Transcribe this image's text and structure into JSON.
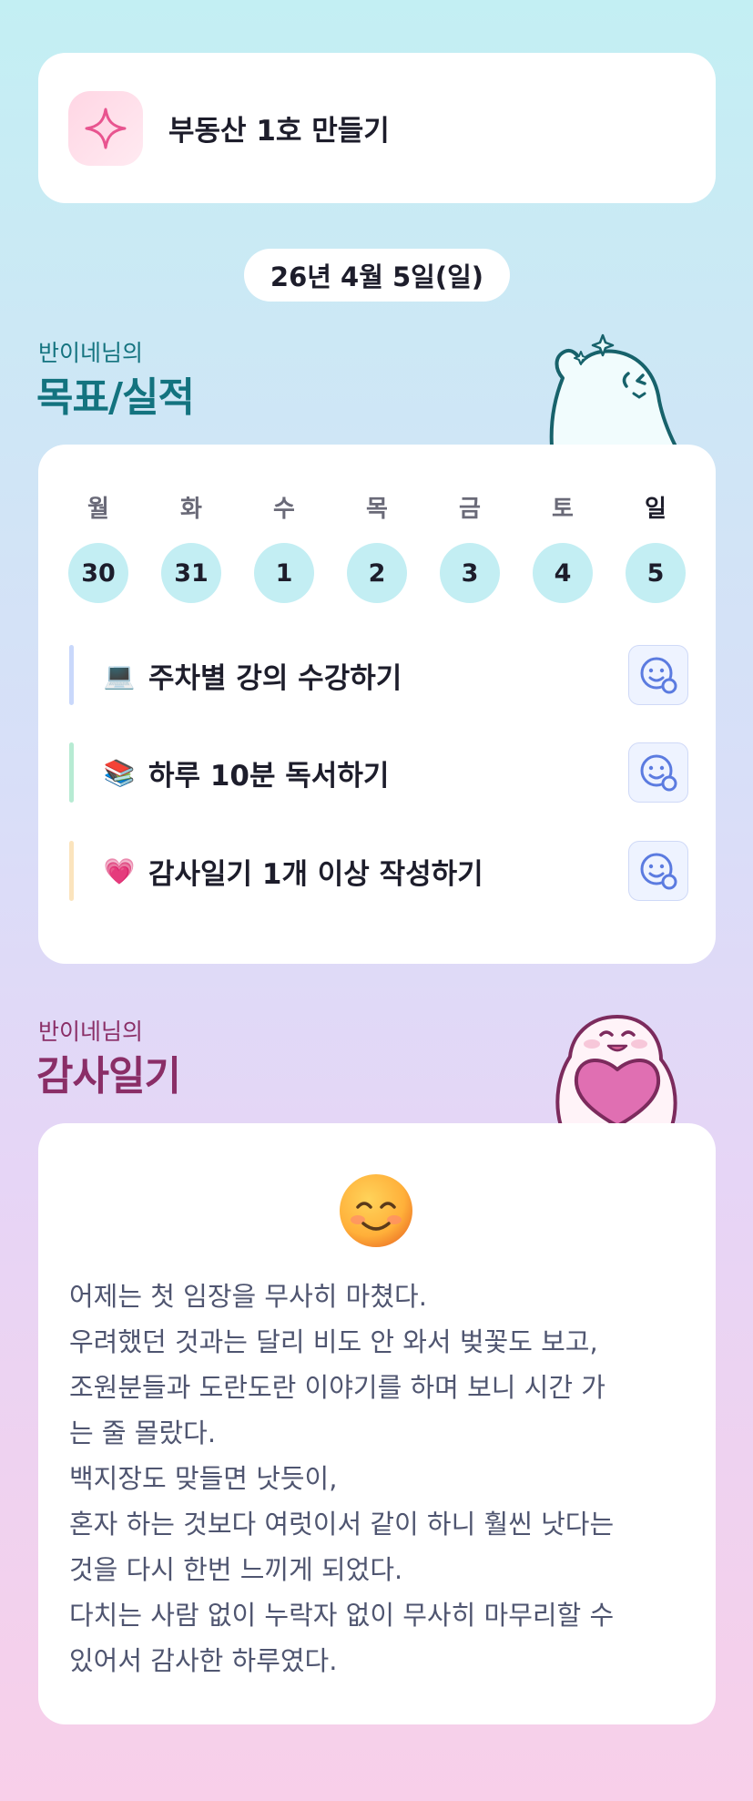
{
  "goal": {
    "title": "부동산 1호 만들기",
    "icon": "sparkle-icon"
  },
  "date": "26년 4월 5일(일)",
  "goals_section": {
    "subtitle": "반이네님의",
    "title": "목표/실적",
    "accent": "#13737f"
  },
  "week": {
    "days": [
      {
        "label": "월",
        "num": "30"
      },
      {
        "label": "화",
        "num": "31"
      },
      {
        "label": "수",
        "num": "1"
      },
      {
        "label": "목",
        "num": "2"
      },
      {
        "label": "금",
        "num": "3"
      },
      {
        "label": "토",
        "num": "4"
      },
      {
        "label": "일",
        "num": "5"
      }
    ]
  },
  "tasks": [
    {
      "emoji": "💻",
      "text": "주차별 강의 수강하기",
      "bar_color": "#c9d8fb"
    },
    {
      "emoji": "📚",
      "text": "하루 10분 독서하기",
      "bar_color": "#b7ebd3"
    },
    {
      "emoji": "💗",
      "text": "감사일기 1개 이상 작성하기",
      "bar_color": "#fbe4bd"
    }
  ],
  "diary_section": {
    "subtitle": "반이네님의",
    "title": "감사일기",
    "accent": "#8a2e67"
  },
  "diary": {
    "mood": "smiling-face-icon",
    "lines": [
      "어제는 첫 임장을 무사히 마쳤다.",
      "우려했던 것과는 달리 비도 안 와서 벚꽃도 보고,",
      "조원분들과 도란도란 이야기를 하며 보니 시간 가",
      "는 줄 몰랐다.",
      "백지장도 맞들면 낫듯이,",
      "혼자 하는 것보다 여럿이서 같이 하니 훨씬 낫다는",
      "것을 다시 한번 느끼게 되었다.",
      "다치는 사람 없이 누락자 없이 무사히 마무리할 수",
      "있어서 감사한 하루였다."
    ]
  }
}
